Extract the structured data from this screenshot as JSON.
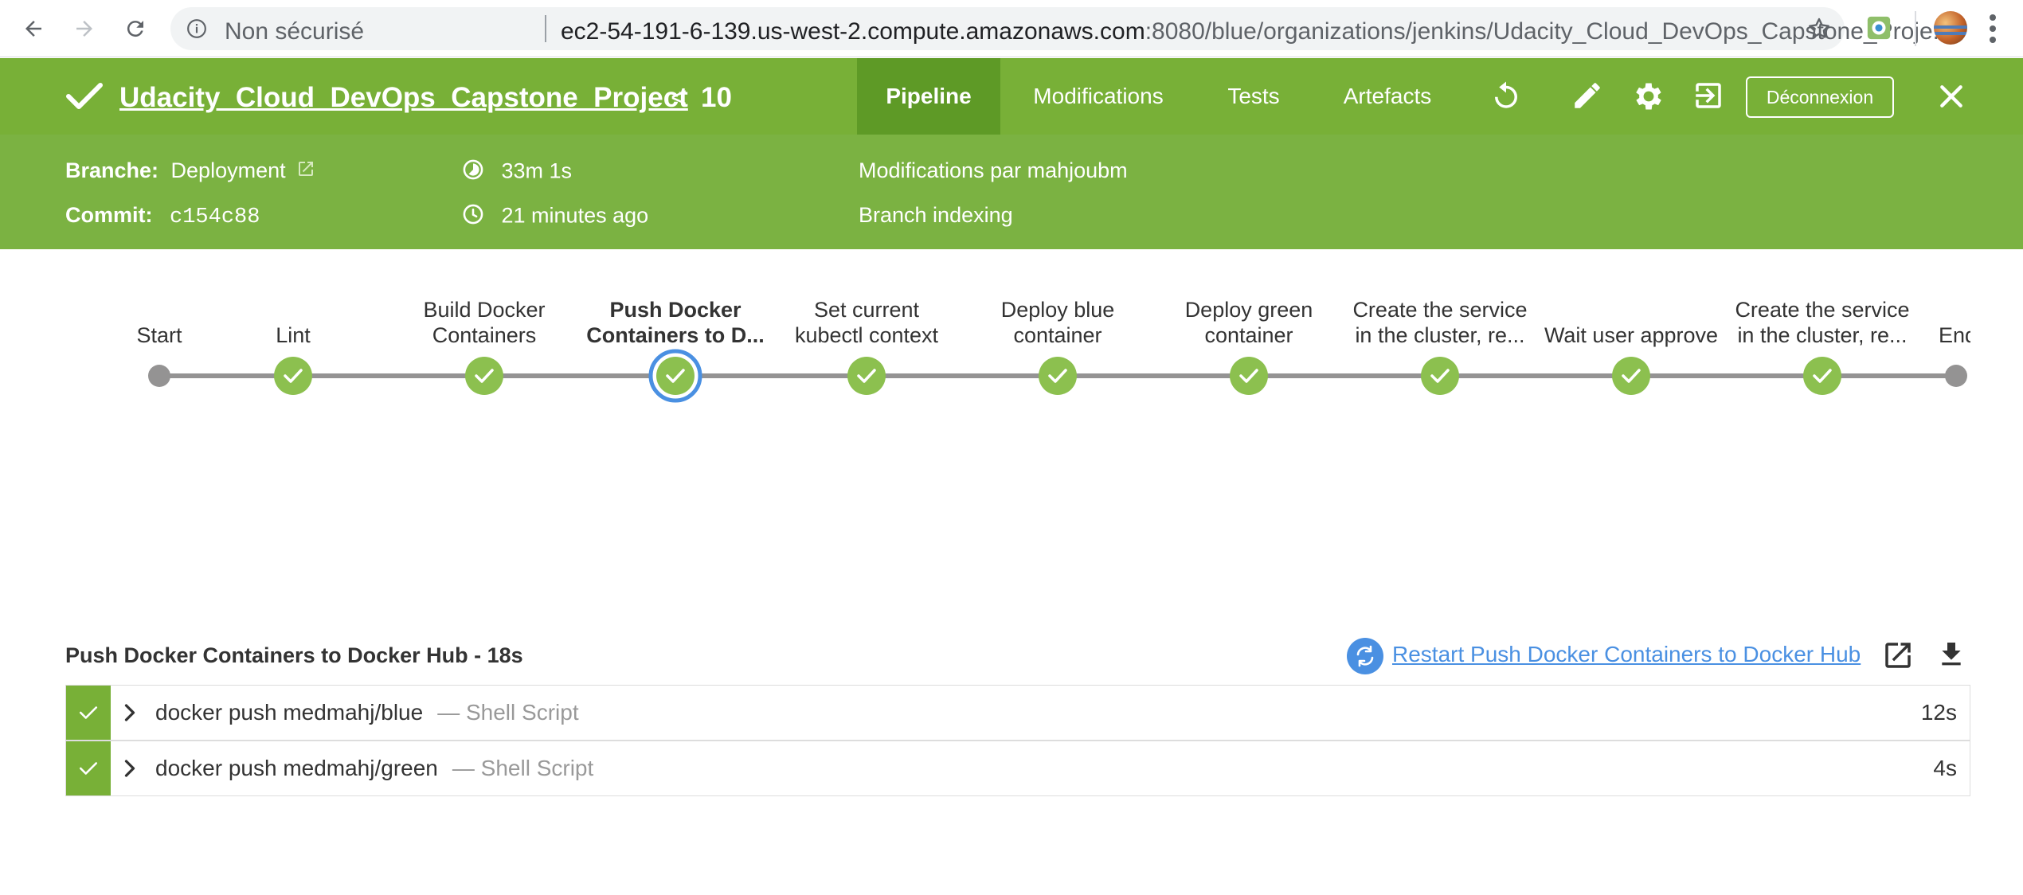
{
  "browser": {
    "security_label": "Non sécurisé",
    "url_host": "ec2-54-191-6-139.us-west-2.compute.amazonaws.com",
    "url_rest": ":8080/blue/organizations/jenkins/Udacity_Cloud_DevOps_Capstone_Proje..."
  },
  "header": {
    "title": "Udacity_Cloud_DevOps_Capstone_Project",
    "prev_symbol": "<",
    "build_number": "10",
    "tabs": [
      {
        "label": "Pipeline"
      },
      {
        "label": "Modifications"
      },
      {
        "label": "Tests"
      },
      {
        "label": "Artefacts"
      }
    ],
    "logout_label": "Déconnexion"
  },
  "summary": {
    "branch_label": "Branche:",
    "branch_value": "Deployment",
    "commit_label": "Commit:",
    "commit_value": "c154c88",
    "duration": "33m 1s",
    "time_ago": "21 minutes ago",
    "changes": "Modifications par mahjoubm",
    "cause": "Branch indexing"
  },
  "pipeline": {
    "stages": [
      {
        "line1": "",
        "line2": "Start",
        "status": "start"
      },
      {
        "line1": "",
        "line2": "Lint",
        "status": "success"
      },
      {
        "line1": "Build Docker",
        "line2": "Containers",
        "status": "success"
      },
      {
        "line1": "Push Docker",
        "line2": "Containers to D...",
        "status": "success",
        "selected": true
      },
      {
        "line1": "Set current",
        "line2": "kubectl context",
        "status": "success"
      },
      {
        "line1": "Deploy blue",
        "line2": "container",
        "status": "success"
      },
      {
        "line1": "Deploy green",
        "line2": "container",
        "status": "success"
      },
      {
        "line1": "Create the service",
        "line2": "in the cluster, re...",
        "status": "success"
      },
      {
        "line1": "",
        "line2": "Wait user approve",
        "status": "success"
      },
      {
        "line1": "Create the service",
        "line2": "in the cluster, re...",
        "status": "success"
      },
      {
        "line1": "",
        "line2": "End",
        "status": "end"
      }
    ]
  },
  "log": {
    "title": "Push Docker Containers to Docker Hub - 18s",
    "restart_label": "Restart Push Docker Containers to Docker Hub",
    "steps": [
      {
        "command": "docker push medmahj/blue",
        "kind": "— Shell Script",
        "duration": "12s"
      },
      {
        "command": "docker push medmahj/green",
        "kind": "— Shell Script",
        "duration": "4s"
      }
    ]
  },
  "colors": {
    "header_green": "#78b037",
    "active_tab": "#5e9a26",
    "success": "#8cc04f",
    "selected_ring": "#4a90e2",
    "link": "#4a90e2"
  },
  "icons": [
    "back-arrow-icon",
    "forward-arrow-icon",
    "reload-icon",
    "info-icon",
    "star-icon",
    "checkmark-icon",
    "replay-icon",
    "edit-icon",
    "gear-icon",
    "exit-icon",
    "close-icon",
    "external-link-icon",
    "duration-icon",
    "clock-icon",
    "restart-icon",
    "open-new-window-icon",
    "download-icon",
    "chevron-right-icon"
  ]
}
